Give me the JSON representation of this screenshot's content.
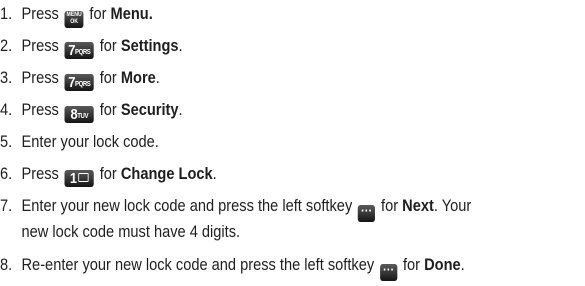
{
  "steps": [
    {
      "num": "1.",
      "pre": "Press",
      "key": {
        "top": "MENU",
        "bottom": "OK"
      },
      "mid": "for",
      "bold": "Menu.",
      "post": ""
    },
    {
      "num": "2.",
      "pre": "Press",
      "key": {
        "big": "7",
        "small": "PQRS"
      },
      "mid": "for",
      "bold": "Settings",
      "post": "."
    },
    {
      "num": "3.",
      "pre": "Press",
      "key": {
        "big": "7",
        "small": "PQRS"
      },
      "mid": "for",
      "bold": "More",
      "post": "."
    },
    {
      "num": "4.",
      "pre": "Press",
      "key": {
        "big": "8",
        "small": "TUV"
      },
      "mid": "for",
      "bold": "Security",
      "post": "."
    },
    {
      "num": "5.",
      "text": "Enter your lock code."
    },
    {
      "num": "6.",
      "pre": "Press",
      "key": {
        "big": "1",
        "icon": "envelope-icon"
      },
      "mid": "for",
      "bold": "Change Lock",
      "post": "."
    },
    {
      "num": "7.",
      "pre": "Enter your new lock code and press the left softkey",
      "key": {
        "glyph": "···"
      },
      "mid": "for",
      "bold": "Next",
      "post": ". Your",
      "line2": "new lock code must have 4 digits."
    },
    {
      "num": "8.",
      "pre": "Re-enter your new lock code and press the left softkey",
      "key": {
        "glyph": "···"
      },
      "mid": "for",
      "bold": "Done",
      "post": "."
    }
  ]
}
